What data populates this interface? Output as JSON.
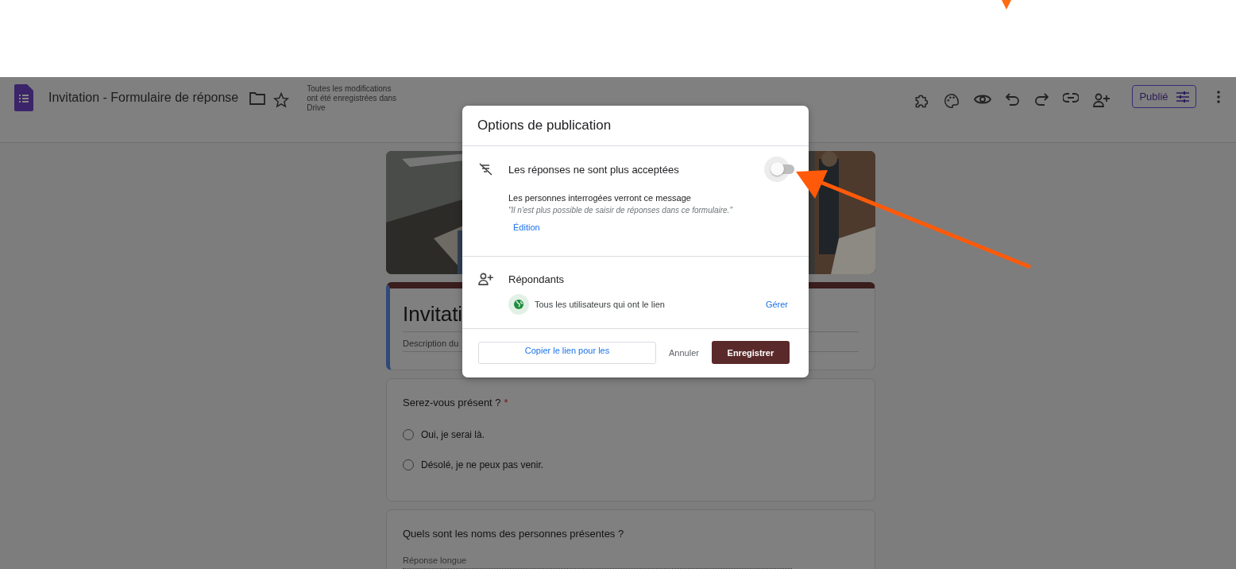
{
  "header": {
    "title": "Invitation - Formulaire de réponse",
    "save_status": "Toutes les modifications ont été enregistrées dans Drive",
    "publish_button": "Publié"
  },
  "form": {
    "title": "Invitati",
    "description": "Description du"
  },
  "questions": [
    {
      "kind": "choice",
      "title": "Serez-vous présent ?",
      "required_mark": "*",
      "options": [
        {
          "label": "Oui, je serai là.",
          "selected": false
        },
        {
          "label": "Désolé, je ne peux pas venir.",
          "selected": false
        }
      ]
    },
    {
      "kind": "paragraph",
      "title": "Quels sont les noms des personnes présentes ?",
      "placeholder": "Réponse longue"
    }
  ],
  "dialog": {
    "title": "Options de publication",
    "accepting": {
      "label": "Les réponses ne sont plus acceptées",
      "on": false,
      "message_heading": "Les personnes interrogées verront ce message",
      "message": "\"Il n'est plus possible de saisir de réponses dans ce formulaire.\"",
      "edit_link": "Édition"
    },
    "respondents": {
      "heading": "Répondants",
      "audience": "Tous les utilisateurs qui ont le lien",
      "manage_link": "Gérer"
    },
    "buttons": {
      "copy": "Copier le lien pour les",
      "cancel": "Annuler",
      "save": "Enregistrer"
    }
  }
}
